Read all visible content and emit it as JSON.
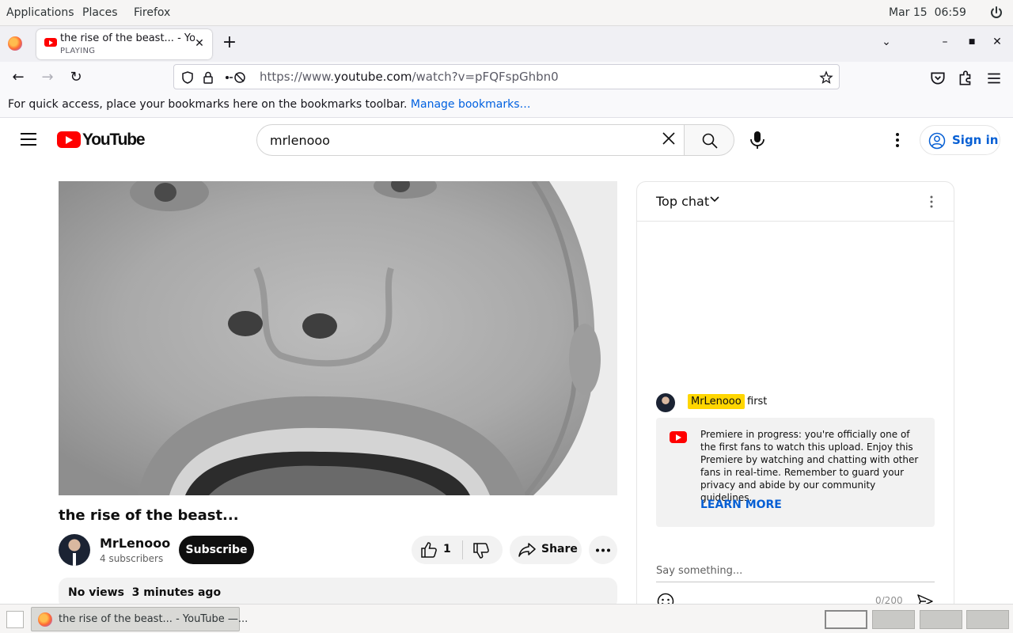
{
  "topbar": {
    "menus": [
      "Applications",
      "Places",
      "Firefox"
    ],
    "date": "Mar 15",
    "time": "06:59"
  },
  "browser": {
    "tab_title": "the rise of the beast... - YouTube",
    "tab_status": "PLAYING",
    "url_scheme": "https://www.",
    "url_host": "youtube.com",
    "url_path": "/watch?v=pFQFspGhbn0",
    "bookmarks_text": "For quick access, place your bookmarks here on the bookmarks toolbar.",
    "bookmarks_link": "Manage bookmarks…"
  },
  "youtube": {
    "logo": "YouTube",
    "search_query": "mrlenooo",
    "sign_in": "Sign in"
  },
  "video": {
    "title": "the rise of the beast...",
    "channel": "MrLenooo",
    "subscribers": "4 subscribers",
    "subscribe_label": "Subscribe",
    "likes": "1",
    "share_label": "Share",
    "views": "No views",
    "posted": "3 minutes ago"
  },
  "chat": {
    "header": "Top chat",
    "messages": [
      {
        "author": "MrLenooo",
        "text": "first"
      }
    ],
    "banner_text": "Premiere in progress: you're officially one of the first fans to watch this upload. Enjoy this Premiere by watching and chatting with other fans in real-time. Remember to guard your privacy and abide by our community guidelines.",
    "learn_more": "LEARN MORE",
    "input_placeholder": "Say something...",
    "char_count": "0/200"
  },
  "taskbar": {
    "window_title": "the rise of the beast... - YouTube —..."
  },
  "colors": {
    "yt_red": "#ff0000",
    "link_blue": "#065fd4",
    "owner_badge": "#ffd600"
  }
}
